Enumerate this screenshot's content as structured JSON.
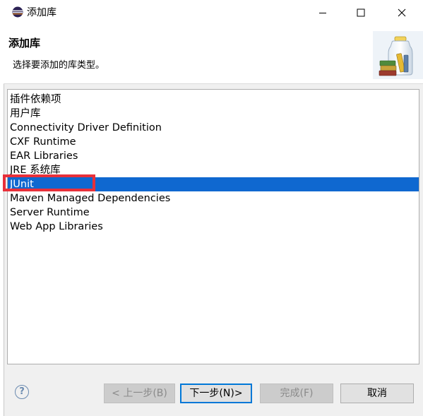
{
  "window": {
    "title": "添加库"
  },
  "header": {
    "title": "添加库",
    "description": "选择要添加的库类型。"
  },
  "library_types": [
    {
      "label": "插件依赖项",
      "selected": false
    },
    {
      "label": "用户库",
      "selected": false
    },
    {
      "label": "Connectivity Driver Definition",
      "selected": false
    },
    {
      "label": "CXF Runtime",
      "selected": false
    },
    {
      "label": "EAR Libraries",
      "selected": false
    },
    {
      "label": "JRE 系统库",
      "selected": false
    },
    {
      "label": "JUnit",
      "selected": true
    },
    {
      "label": "Maven Managed Dependencies",
      "selected": false
    },
    {
      "label": "Server Runtime",
      "selected": false
    },
    {
      "label": "Web App Libraries",
      "selected": false
    }
  ],
  "footer": {
    "help_glyph": "?",
    "back_label": "< 上一步(B)",
    "next_label": "下一步(N)>",
    "finish_label": "完成(F)",
    "cancel_label": "取消"
  },
  "colors": {
    "selection": "#0f68d0",
    "highlight_box": "#e8303a"
  }
}
